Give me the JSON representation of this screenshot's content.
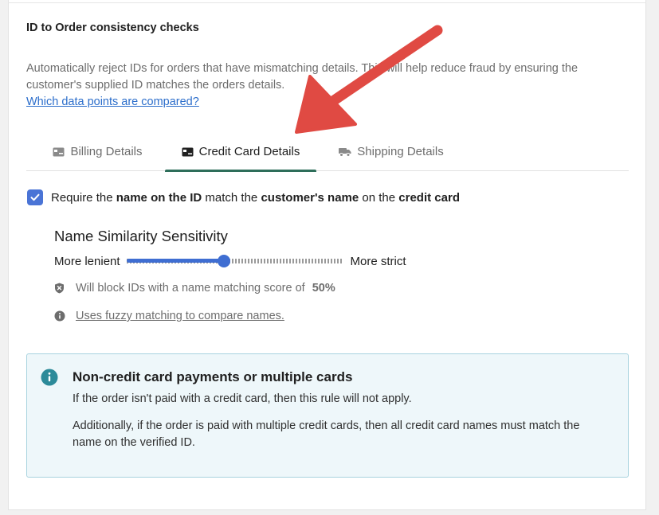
{
  "section": {
    "title": "ID to Order consistency checks",
    "description": "Automatically reject IDs for orders that have mismatching details. This will help reduce fraud by ensuring the customer's supplied ID matches the orders details.",
    "link_label": "Which data points are compared?"
  },
  "tabs": [
    {
      "label": "Billing Details",
      "icon": "billing-card-icon",
      "active": false
    },
    {
      "label": "Credit Card Details",
      "icon": "credit-card-icon",
      "active": true
    },
    {
      "label": "Shipping Details",
      "icon": "truck-icon",
      "active": false
    }
  ],
  "rule": {
    "checked": true,
    "text_parts": [
      "Require the ",
      "name on the ID",
      " match the ",
      "customer's name",
      " on the ",
      "credit card"
    ]
  },
  "sensitivity": {
    "title": "Name Similarity Sensitivity",
    "min_label": "More lenient",
    "max_label": "More strict",
    "level_percent": 45,
    "block_text": "Will block IDs with a name matching score of",
    "block_value": "50%",
    "fuzzy_link": "Uses fuzzy matching to compare names."
  },
  "banner": {
    "title": "Non-credit card payments or multiple cards",
    "p1": "If the order isn't paid with a credit card, then this rule will not apply.",
    "p2": "Additionally, if the order is paid with multiple credit cards, then all credit card names must match the name on the verified ID."
  },
  "colors": {
    "accent": "#3f6ed2",
    "tab_indicator": "#2e6e5a",
    "annotation_arrow": "#e04a43",
    "banner_bg": "#eef7fa",
    "banner_border": "#a8d3df",
    "info_icon": "#2c8a99"
  }
}
